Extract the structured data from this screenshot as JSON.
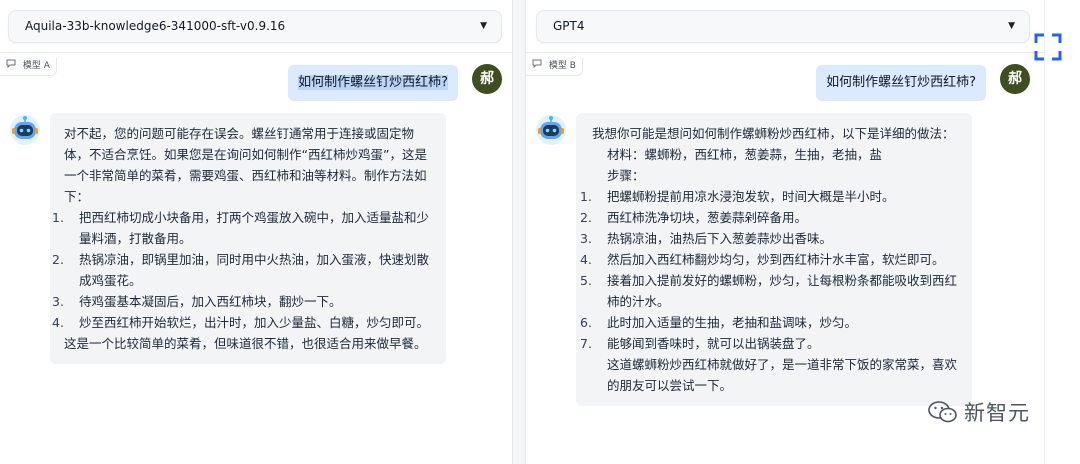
{
  "model_a": {
    "select_value": "Aquila-33b-knowledge6-341000-sft-v0.9.16",
    "label": "模型 A",
    "user_message": "如何制作螺丝钉炒西红柿?",
    "user_avatar": "郝",
    "reply": {
      "intro": "对不起，您的问题可能存在误会。螺丝钉通常用于连接或固定物体，不适合烹饪。如果您是在询问如何制作“西红柿炒鸡蛋”，这是一个非常简单的菜肴，需要鸡蛋、西红柿和油等材料。制作方法如下：",
      "steps": [
        "把西红柿切成小块备用，打两个鸡蛋放入碗中，加入适量盐和少量料酒，打散备用。",
        "热锅凉油，即锅里加油，同时用中火热油，加入蛋液，快速划散成鸡蛋花。",
        "待鸡蛋基本凝固后，加入西红柿块，翻炒一下。",
        "炒至西红柿开始软烂，出汁时，加入少量盐、白糖，炒匀即可。"
      ],
      "outro": "这是一个比较简单的菜肴，但味道很不错，也很适合用来做早餐。"
    }
  },
  "model_b": {
    "select_value": "GPT4",
    "label": "模型 B",
    "user_message": "如何制作螺丝钉炒西红柿?",
    "user_avatar": "郝",
    "reply": {
      "intro": "我想你可能是想问如何制作螺蛳粉炒西红柿，以下是详细的做法：",
      "materials": "材料：螺蛳粉，西红柿，葱姜蒜，生抽，老抽，盐",
      "steps_label": "步骤：",
      "steps": [
        "把螺蛳粉提前用凉水浸泡发软，时间大概是半小时。",
        "西红柿洗净切块，葱姜蒜剁碎备用。",
        "热锅凉油，油热后下入葱姜蒜炒出香味。",
        "然后加入西红柿翻炒均匀，炒到西红柿汁水丰富，软烂即可。",
        "接着加入提前发好的螺蛳粉，炒匀，让每根粉条都能吸收到西红柿的汁水。",
        "此时加入适量的生抽，老抽和盐调味，炒匀。",
        "能够闻到香味时，就可以出锅装盘了。"
      ],
      "outro": "这道螺蛳粉炒西红柿就做好了，是一道非常下饭的家常菜，喜欢的朋友可以尝试一下。"
    }
  },
  "watermark": "新智元",
  "colors": {
    "user_bubble": "#dbeafe",
    "bot_bubble": "#f3f4f6",
    "avatar_user": "#3f4d1f",
    "fullscreen_icon": "#2563eb"
  },
  "icons": {
    "select_caret": "▼",
    "chat_tag_icon": "💬"
  }
}
